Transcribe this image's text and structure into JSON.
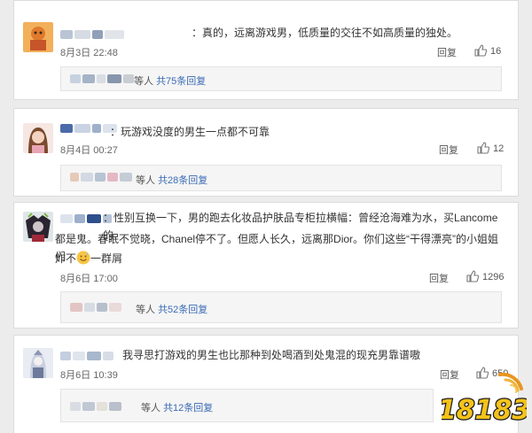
{
  "comments": [
    {
      "content": "真的，远离游戏男，低质量的交往不如高质量的独处。",
      "time": "8月3日 22:48",
      "reply_label": "回复",
      "likes": "16",
      "sub_prefix": "等人",
      "sub_count": "共75条回复"
    },
    {
      "content": "玩游戏没度的男生一点都不可靠",
      "time": "8月4日 00:27",
      "reply_label": "回复",
      "likes": "12",
      "sub_prefix": "等人",
      "sub_count": "共28条回复"
    },
    {
      "content_line1": "性别互换一下，男的跑去化妆品护肤品专柜拉横幅：曾经沧海难为水，买Lancome的",
      "content_line2": "都是鬼。春眠不觉晓，Chanel停不了。但愿人长久，远离那Dior。你们这些“干得漂亮”的小姐姐们",
      "content_line3a": "炸不",
      "content_line3b": "一群屑",
      "time": "8月6日 17:00",
      "reply_label": "回复",
      "likes": "1296",
      "sub_prefix": "等人",
      "sub_count": "共52条回复"
    },
    {
      "content": "我寻思打游戏的男生也比那种到处喝酒到处鬼混的现充男靠谱嗷",
      "time": "8月6日 10:39",
      "reply_label": "回复",
      "likes": "650",
      "sub_prefix": "等人",
      "sub_count": "共12条回复"
    }
  ],
  "icons": {
    "like": "thumbs-up-icon",
    "emoji": "sweat-smile-emoji-icon"
  },
  "watermark": {
    "text": "18183"
  },
  "colors": {
    "link": "#3a6bb5",
    "like_icon": "#777777",
    "sub_bg": "#f5f5f5"
  }
}
